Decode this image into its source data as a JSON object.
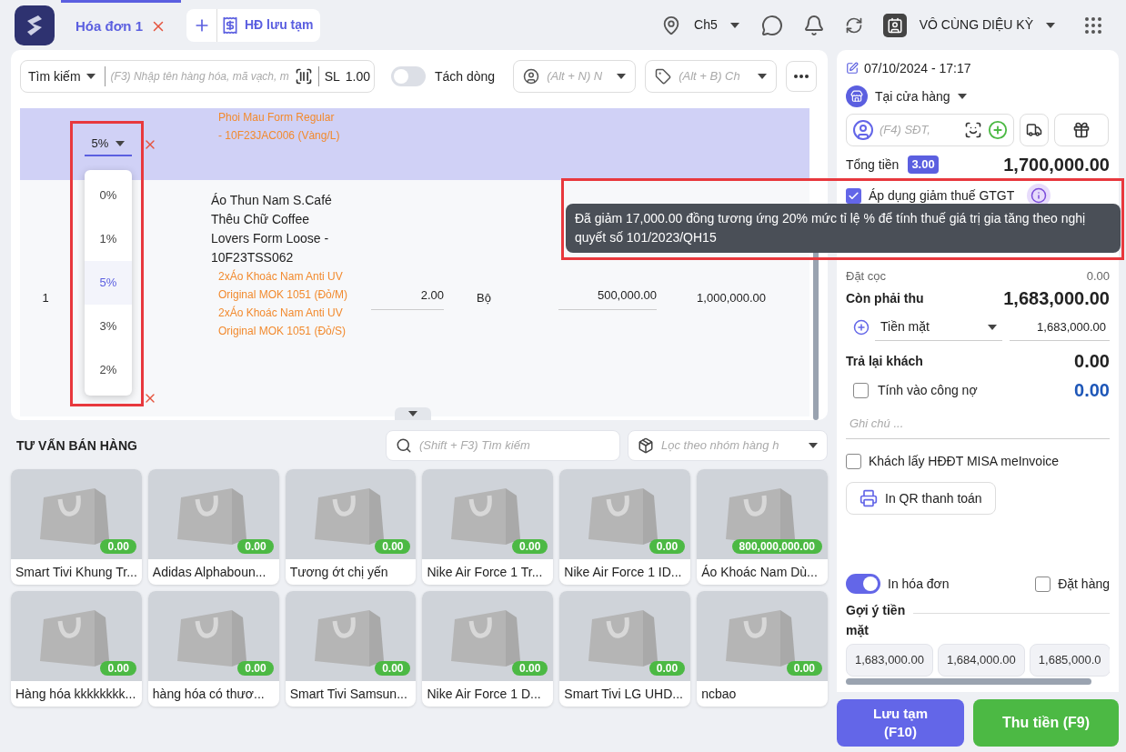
{
  "header": {
    "tabs": [
      {
        "label": "Hóa đơn 1",
        "selected": true
      }
    ],
    "saved_button": "HĐ lưu tạm",
    "branch": "Ch5",
    "user": "VÔ CÙNG DIỆU KỲ"
  },
  "toolbar": {
    "search_mode": "Tìm kiếm",
    "search_placeholder": "(F3) Nhập tên hàng hóa, mã vạch, m",
    "qty_label": "SL",
    "qty": "1.00",
    "split": {
      "label": "Tách dòng",
      "on": false
    },
    "staff_placeholder": "(Alt + N) N",
    "price_list_placeholder": "(Alt + B) Ch"
  },
  "lines": [
    {
      "selected": true,
      "vat": "5%",
      "components": [
        "Phoi Mau Form Regular",
        "- 10F23JAC006 (Vàng/L)"
      ]
    },
    {
      "selected": false,
      "index": "1",
      "name": "Áo Thun Nam S.Café Thêu Chữ Coffee Lovers Form Loose - 10F23TSS062",
      "components": [
        "2xÁo Khoác Nam Anti UV Original MOK 1051 (Đỏ/M)",
        "2xÁo Khoác Nam Anti UV Original MOK 1051 (Đỏ/S)"
      ],
      "qty": "2.00",
      "unit": "Bộ",
      "price": "500,000.00",
      "total": "1,000,000.00"
    }
  ],
  "vat_dropdown": [
    {
      "label": "0%",
      "selected": false
    },
    {
      "label": "1%",
      "selected": false
    },
    {
      "label": "5%",
      "selected": true
    },
    {
      "label": "3%",
      "selected": false
    },
    {
      "label": "2%",
      "selected": false
    }
  ],
  "suggest": {
    "title": "TƯ VẤN BÁN HÀNG",
    "search_placeholder": "(Shift + F3) Tìm kiếm",
    "filter_placeholder": "Lọc theo nhóm hàng h",
    "products": [
      {
        "name": "Smart Tivi Khung Tr...",
        "price": "0.00"
      },
      {
        "name": "Adidas Alphaboun...",
        "price": "0.00"
      },
      {
        "name": "Tương ớt chị yến",
        "price": "0.00"
      },
      {
        "name": "Nike Air Force 1 Tr...",
        "price": "0.00"
      },
      {
        "name": "Nike Air Force 1 ID...",
        "price": "0.00"
      },
      {
        "name": "Áo Khoác Nam Dù...",
        "price": "800,000,000.00"
      },
      {
        "name": "Hàng hóa kkkkkkkk...",
        "price": "0.00"
      },
      {
        "name": "hàng hóa có thươ...",
        "price": "0.00"
      },
      {
        "name": "Smart Tivi Samsun...",
        "price": "0.00"
      },
      {
        "name": "Nike Air Force 1 D...",
        "price": "0.00"
      },
      {
        "name": "Smart Tivi LG UHD...",
        "price": "0.00"
      },
      {
        "name": "ncbao",
        "price": "0.00"
      }
    ]
  },
  "checkout": {
    "datetime": "07/10/2024 - 17:17",
    "channel": "Tại cửa hàng",
    "customer_placeholder": "(F4) SĐT,",
    "total_label": "Tổng tiền",
    "total_badge": "3.00",
    "total": "1,700,000.00",
    "vat_discount": {
      "label": "Áp dụng giảm thuế GTGT",
      "checked": true
    },
    "tooltip": "Đã giảm 17,000.00 đồng tương ứng 20% mức tỉ lệ % để tính thuế giá trị gia tăng theo nghị quyết số 101/2023/QH15",
    "deposit_label": "Đặt cọc",
    "deposit": "0.00",
    "due_label": "Còn phải thu",
    "due": "1,683,000.00",
    "payment_method": "Tiền mặt",
    "payment_amount": "1,683,000.00",
    "change_label": "Trả lại khách",
    "change": "0.00",
    "debt": {
      "label": "Tính vào công nợ",
      "checked": false,
      "amount": "0.00"
    },
    "note_placeholder": "Ghi chú ...",
    "einvoice": {
      "label": "Khách lấy HĐĐT MISA meInvoice",
      "checked": false
    },
    "qr_button": "In QR thanh toán",
    "print": {
      "label": "In hóa đơn",
      "on": true
    },
    "order": {
      "label": "Đặt hàng",
      "checked": false
    },
    "cash_suggest_label": "Gợi ý tiền mặt",
    "cash_suggestions": [
      "1,683,000.00",
      "1,684,000.00",
      "1,685,000.0"
    ],
    "save_button": "Lưu tạm (F10)",
    "pay_button": "Thu tiền (F9)"
  }
}
